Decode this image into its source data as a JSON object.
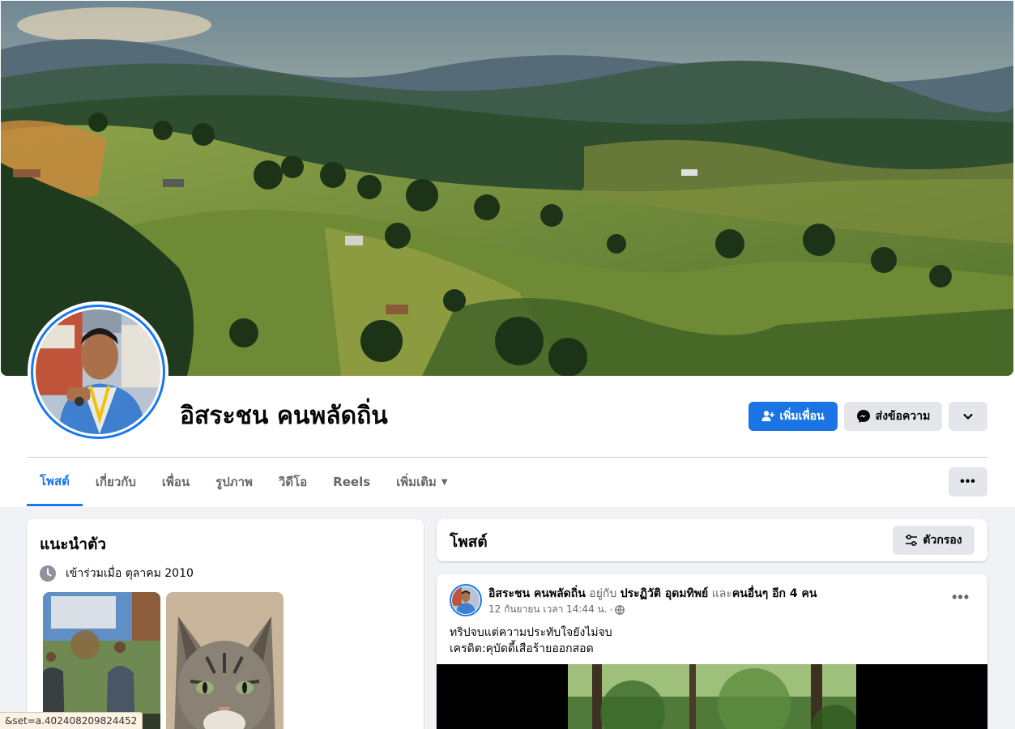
{
  "profile": {
    "name": "อิสระชน คนพลัดถิ่น"
  },
  "actions": {
    "add_friend": "เพิ่มเพื่อน",
    "message": "ส่งข้อความ"
  },
  "tabs": [
    {
      "label": "โพสต์",
      "active": true
    },
    {
      "label": "เกี่ยวกับ"
    },
    {
      "label": "เพื่อน"
    },
    {
      "label": "รูปภาพ"
    },
    {
      "label": "วิดีโอ"
    },
    {
      "label": "Reels"
    },
    {
      "label": "เพิ่มเติม"
    }
  ],
  "intro": {
    "title": "แนะนำตัว",
    "joined": "เข้าร่วมเมื่อ ตุลาคม 2010"
  },
  "posts_header": {
    "title": "โพสต์",
    "filter_label": "ตัวกรอง"
  },
  "post": {
    "author": "อิสระชน คนพลัดถิ่น",
    "with_word": "อยู่กับ",
    "tagged": "ประฏิวัติ อุดมทิพย์",
    "and_word": "และ",
    "others": "คนอื่นๆ อีก 4 คน",
    "timestamp": "12 กันยายน เวลา 14:44 น.",
    "text_line1": "ทริปจบแต่ความประทับใจยังไม่จบ",
    "text_line2": "เครดิต:คุบัดดี้เสือร้ายออกสอด"
  },
  "status_bar": {
    "url_fragment": "&set=a.402408209824452"
  },
  "colors": {
    "accent": "#1877f2",
    "button_primary": "#1b74e4",
    "button_secondary": "#e4e6eb",
    "page_bg": "#f0f2f5"
  },
  "icons": [
    "add-friend-icon",
    "messenger-icon",
    "chevron-down-icon",
    "more-icon",
    "clock-icon",
    "filter-icon",
    "globe-icon"
  ]
}
